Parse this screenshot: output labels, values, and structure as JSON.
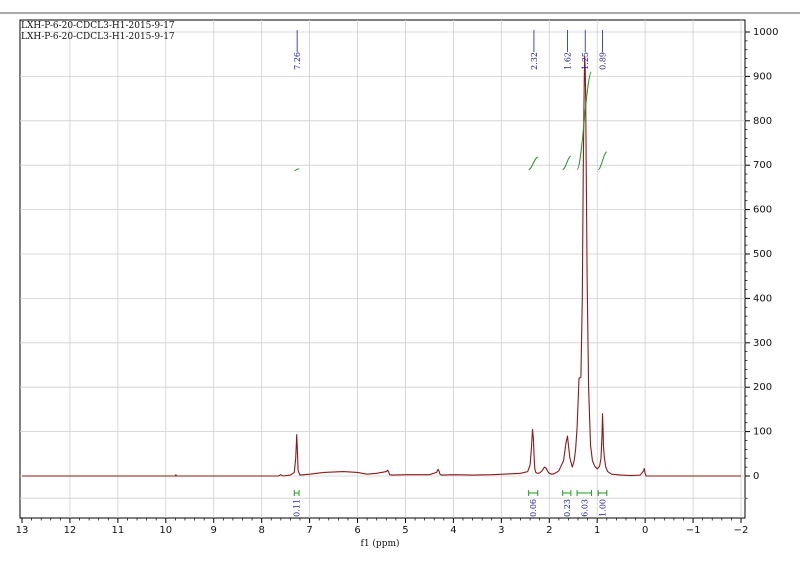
{
  "chart_data": {
    "type": "line",
    "titles": [
      "LXH-P-6-20-CDCL3-H1-2015-9-17",
      "LXH-P-6-20-CDCL3-H1-2015-9-17"
    ],
    "xlabel": "f1 (ppm)",
    "ylabel": "",
    "xlim": [
      13,
      -2
    ],
    "ylim": [
      -100,
      1020
    ],
    "x_ticks": [
      13,
      12,
      11,
      10,
      9,
      8,
      7,
      6,
      5,
      4,
      3,
      2,
      1,
      0,
      -1,
      -2
    ],
    "x_tick_labels": [
      "13",
      "12",
      "11",
      "10",
      "9",
      "8",
      "7",
      "6",
      "5",
      "4",
      "3",
      "2",
      "1",
      "0",
      "−1",
      "−2"
    ],
    "y_ticks": [
      1000,
      900,
      800,
      700,
      600,
      500,
      400,
      300,
      200,
      100,
      0
    ],
    "y_tick_labels": [
      "1000",
      "900",
      "800",
      "700",
      "600",
      "500",
      "400",
      "300",
      "200",
      "100",
      "0"
    ],
    "grid": true,
    "series": [
      {
        "color": "#8b1a1a",
        "x": [
          13.0,
          9.8,
          9.79,
          9.78,
          7.65,
          7.6,
          7.55,
          7.4,
          7.32,
          7.29,
          7.28,
          7.27,
          7.26,
          7.25,
          7.24,
          7.2,
          7.0,
          6.7,
          6.3,
          6.0,
          5.8,
          5.6,
          5.4,
          5.37,
          5.35,
          5.33,
          5.28,
          5.0,
          4.5,
          4.35,
          4.32,
          4.3,
          4.28,
          4.25,
          4.0,
          3.6,
          3.2,
          2.8,
          2.6,
          2.45,
          2.4,
          2.37,
          2.35,
          2.33,
          2.32,
          2.31,
          2.3,
          2.28,
          2.25,
          2.2,
          2.15,
          2.1,
          2.06,
          2.03,
          2.0,
          1.95,
          1.9,
          1.85,
          1.8,
          1.7,
          1.65,
          1.62,
          1.6,
          1.57,
          1.52,
          1.48,
          1.45,
          1.42,
          1.38,
          1.34,
          1.31,
          1.29,
          1.27,
          1.26,
          1.25,
          1.24,
          1.23,
          1.21,
          1.18,
          1.14,
          1.1,
          1.05,
          1.0,
          0.95,
          0.92,
          0.9,
          0.89,
          0.88,
          0.87,
          0.85,
          0.82,
          0.78,
          0.7,
          0.5,
          0.3,
          0.1,
          0.03,
          0.02,
          0.0,
          -0.02,
          -0.5,
          -1.0,
          -1.5,
          -2.0
        ],
        "y": [
          0,
          0,
          3,
          0,
          0,
          3,
          0,
          2,
          8,
          40,
          65,
          93,
          75,
          45,
          12,
          2,
          4,
          8,
          10,
          8,
          4,
          6,
          10,
          13,
          9,
          3,
          2,
          3,
          3,
          8,
          15,
          11,
          4,
          2,
          3,
          2,
          3,
          5,
          6,
          10,
          25,
          65,
          105,
          85,
          55,
          30,
          15,
          8,
          6,
          7,
          12,
          20,
          17,
          10,
          6,
          4,
          5,
          8,
          12,
          35,
          75,
          90,
          70,
          40,
          20,
          35,
          60,
          110,
          220,
          222,
          400,
          700,
          900,
          945,
          915,
          850,
          700,
          450,
          200,
          70,
          35,
          22,
          16,
          22,
          40,
          90,
          140,
          110,
          70,
          40,
          20,
          10,
          4,
          2,
          1,
          2,
          12,
          17,
          6,
          0,
          0,
          0,
          0,
          0
        ]
      }
    ],
    "peak_labels": [
      "7.26",
      "2.32",
      "1.62",
      "1.25",
      "0.89"
    ],
    "peak_positions": [
      7.26,
      2.32,
      1.62,
      1.25,
      0.89
    ],
    "integrals": [
      {
        "x_from": 7.32,
        "x_to": 7.22,
        "value": "0.11",
        "curve_y": [
          688,
          692
        ]
      },
      {
        "x_from": 2.43,
        "x_to": 2.24,
        "value": "0.06",
        "curve_y": [
          690,
          718
        ]
      },
      {
        "x_from": 1.72,
        "x_to": 1.55,
        "value": "0.23",
        "curve_y": [
          690,
          720
        ]
      },
      {
        "x_from": 1.42,
        "x_to": 1.12,
        "value": "6.03",
        "curve_y": [
          690,
          910
        ]
      },
      {
        "x_from": 0.98,
        "x_to": 0.8,
        "value": "1.00",
        "curve_y": [
          690,
          730
        ]
      }
    ]
  }
}
